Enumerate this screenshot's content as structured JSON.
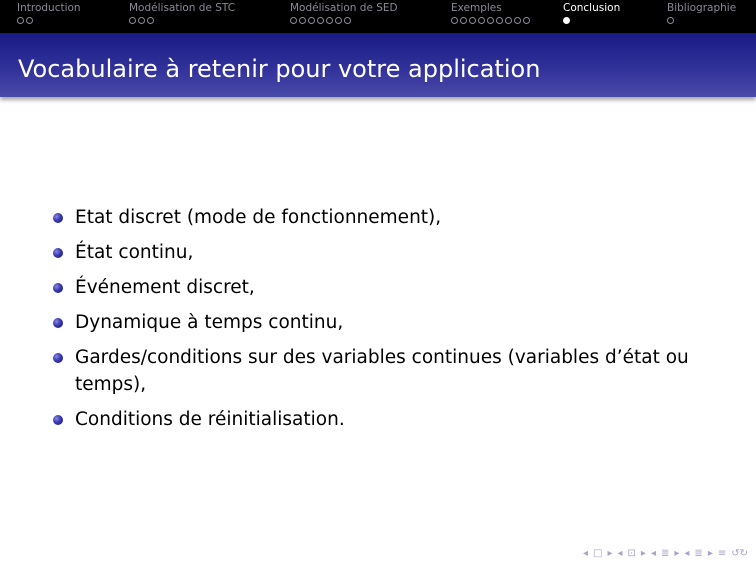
{
  "nav": {
    "sections": [
      {
        "name": "Introduction",
        "dots": 2,
        "filled": 0
      },
      {
        "name": "Modélisation de STC",
        "dots": 3,
        "filled": 0
      },
      {
        "name": "Modélisation de SED",
        "dots": 7,
        "filled": 0
      },
      {
        "name": "Exemples",
        "dots": 9,
        "filled": 0
      },
      {
        "name": "Conclusion",
        "dots": 1,
        "filled": 1,
        "active": true
      },
      {
        "name": "Bibliographie",
        "dots": 1,
        "filled": 0
      }
    ]
  },
  "frame": {
    "title": "Vocabulaire à retenir pour votre application"
  },
  "content": {
    "items": [
      "Etat discret (mode de fonctionnement),",
      "État continu,",
      "Événement discret,",
      "Dynamique à temps continu,",
      "Gardes/conditions sur des variables continues (variables d’état ou temps),",
      "Conditions de réinitialisation."
    ]
  },
  "navigation_symbols": {
    "frame_prev": "◂",
    "frame_icon": "□",
    "frame_next": "▸",
    "sub_prev": "◂",
    "sub_icon": "⊡",
    "sub_next": "▸",
    "sec_prev": "◂",
    "sec_icon": "≣",
    "sec_next": "▸",
    "subsec_prev": "◂",
    "subsec_icon": "≣",
    "subsec_next": "▸",
    "outline_icon": "≡",
    "search_icon": "↺↻"
  },
  "colors": {
    "nav_bg": "#000000",
    "nav_text": "#8a8a99",
    "nav_active": "#ffffff",
    "title_bg": "#2a2a94",
    "title_text": "#ffffff",
    "bullet": "#3838b0"
  }
}
